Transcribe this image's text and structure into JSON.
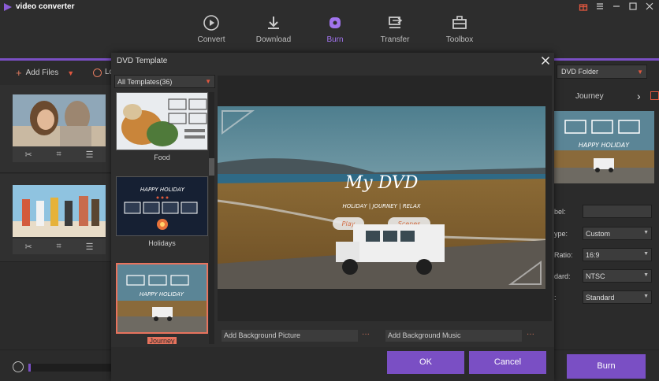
{
  "app": {
    "title": "video converter"
  },
  "nav": [
    {
      "label": "Convert",
      "icon": "play-circle-icon"
    },
    {
      "label": "Download",
      "icon": "download-icon"
    },
    {
      "label": "Burn",
      "icon": "burn-disc-icon",
      "active": true
    },
    {
      "label": "Transfer",
      "icon": "transfer-icon"
    },
    {
      "label": "Toolbox",
      "icon": "toolbox-icon"
    }
  ],
  "toolbar": {
    "add_files": "Add Files",
    "load_partial": "Lo"
  },
  "dialog": {
    "title": "DVD Template",
    "template_filter": "All Templates(36)",
    "templates": [
      {
        "name": "Food"
      },
      {
        "name": "Holidays"
      },
      {
        "name": "Journey",
        "selected": true
      }
    ],
    "preview": {
      "title": "My DVD",
      "subtitle": "HOLIDAY | JOURNEY | RELAX",
      "buttons": [
        "Play",
        "Scenes"
      ]
    },
    "bg_picture": "Add Background Picture",
    "bg_music": "Add Background Music",
    "more": "···",
    "ok": "OK",
    "cancel": "Cancel"
  },
  "right_panel": {
    "output": "DVD Folder",
    "template_name": "Journey",
    "thumb_text": "HAPPY HOLIDAY",
    "fields": [
      {
        "label": "bel:",
        "value": ""
      },
      {
        "label": "ype:",
        "value": "Custom"
      },
      {
        "label": "Ratio:",
        "value": "16:9"
      },
      {
        "label": "dard:",
        "value": "NTSC"
      },
      {
        "label": ":",
        "value": "Standard"
      }
    ]
  },
  "template_thumb_text": "HAPPY HOLIDAY",
  "burn_button": "Burn",
  "colors": {
    "accent": "#7a4fc4",
    "highlight": "#e8735d"
  }
}
